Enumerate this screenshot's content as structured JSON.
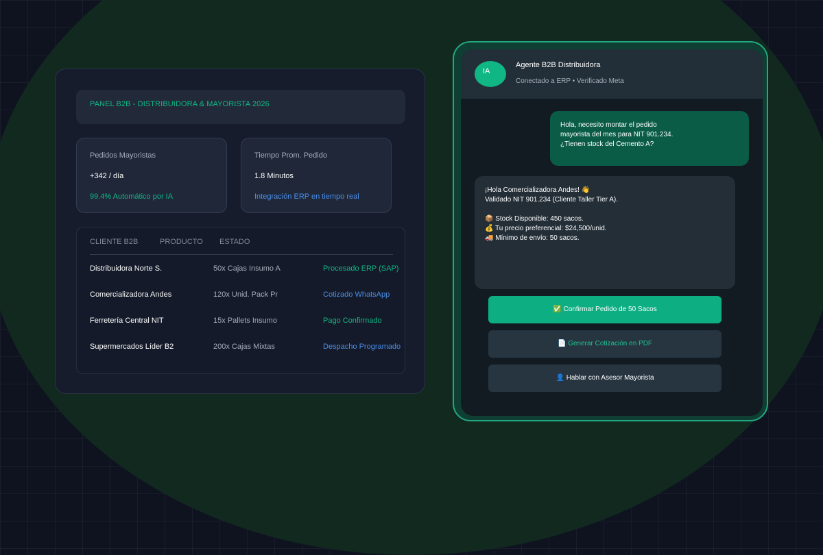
{
  "dashboard": {
    "header_title": "PANEL B2B - DISTRIBUIDORA & MAYORISTA 2026",
    "stats": [
      {
        "label": "Pedidos Mayoristas",
        "value": "+342 / día",
        "note": "99.4% Automático por IA",
        "note_color": "#11b886"
      },
      {
        "label": "Tiempo Prom. Pedido",
        "value": "1.8 Minutos",
        "note": "Integración ERP en tiempo real",
        "note_color": "#4b8fe8"
      }
    ],
    "table": {
      "headers": [
        "CLIENTE B2B",
        "PRODUCTO",
        "ESTADO"
      ],
      "rows": [
        {
          "client": "Distribuidora Norte S.",
          "product": "50x Cajas Insumo A",
          "status": "Procesado ERP (SAP)",
          "status_color": "#11b886"
        },
        {
          "client": "Comercializadora Andes",
          "product": "120x Unid. Pack Pr",
          "status": "Cotizado WhatsApp",
          "status_color": "#4b8fe8"
        },
        {
          "client": "Ferretería Central NIT",
          "product": "15x Pallets Insumo",
          "status": "Pago Confirmado",
          "status_color": "#11b886"
        },
        {
          "client": "Supermercados Líder B2",
          "product": "200x Cajas Mixtas",
          "status": "Despacho Programado",
          "status_color": "#4b8fe8"
        }
      ]
    }
  },
  "chat": {
    "avatar_text": "IA",
    "agent_name": "Agente B2B Distribuidora",
    "agent_status": "Conectado a ERP • Verificado Meta",
    "user_message": [
      "Hola, necesito montar el pedido",
      "mayorista del mes para NIT 901.234.",
      "¿Tienen stock del Cemento A?"
    ],
    "bot_message": [
      "¡Hola Comercializadora Andes! 👋",
      "Validado NIT 901.234 (Cliente Taller Tier A).",
      "",
      "📦 Stock Disponible: 450 sacos.",
      "💰 Tu precio preferencial: $24,500/unid.",
      "🚚 Mínimo de envío: 50 sacos."
    ],
    "actions": [
      {
        "label": "✅ Confirmar Pedido de 50 Sacos",
        "icon": "check-icon"
      },
      {
        "label": "📄 Generar Cotización en PDF",
        "icon": "document-icon"
      },
      {
        "label": "👤 Hablar con Asesor Mayorista",
        "icon": "person-icon"
      }
    ]
  },
  "colors": {
    "accent_green": "#11b886",
    "accent_blue": "#4b8fe8",
    "user_bubble": "#0a5c47",
    "phone_border": "#22a982"
  }
}
